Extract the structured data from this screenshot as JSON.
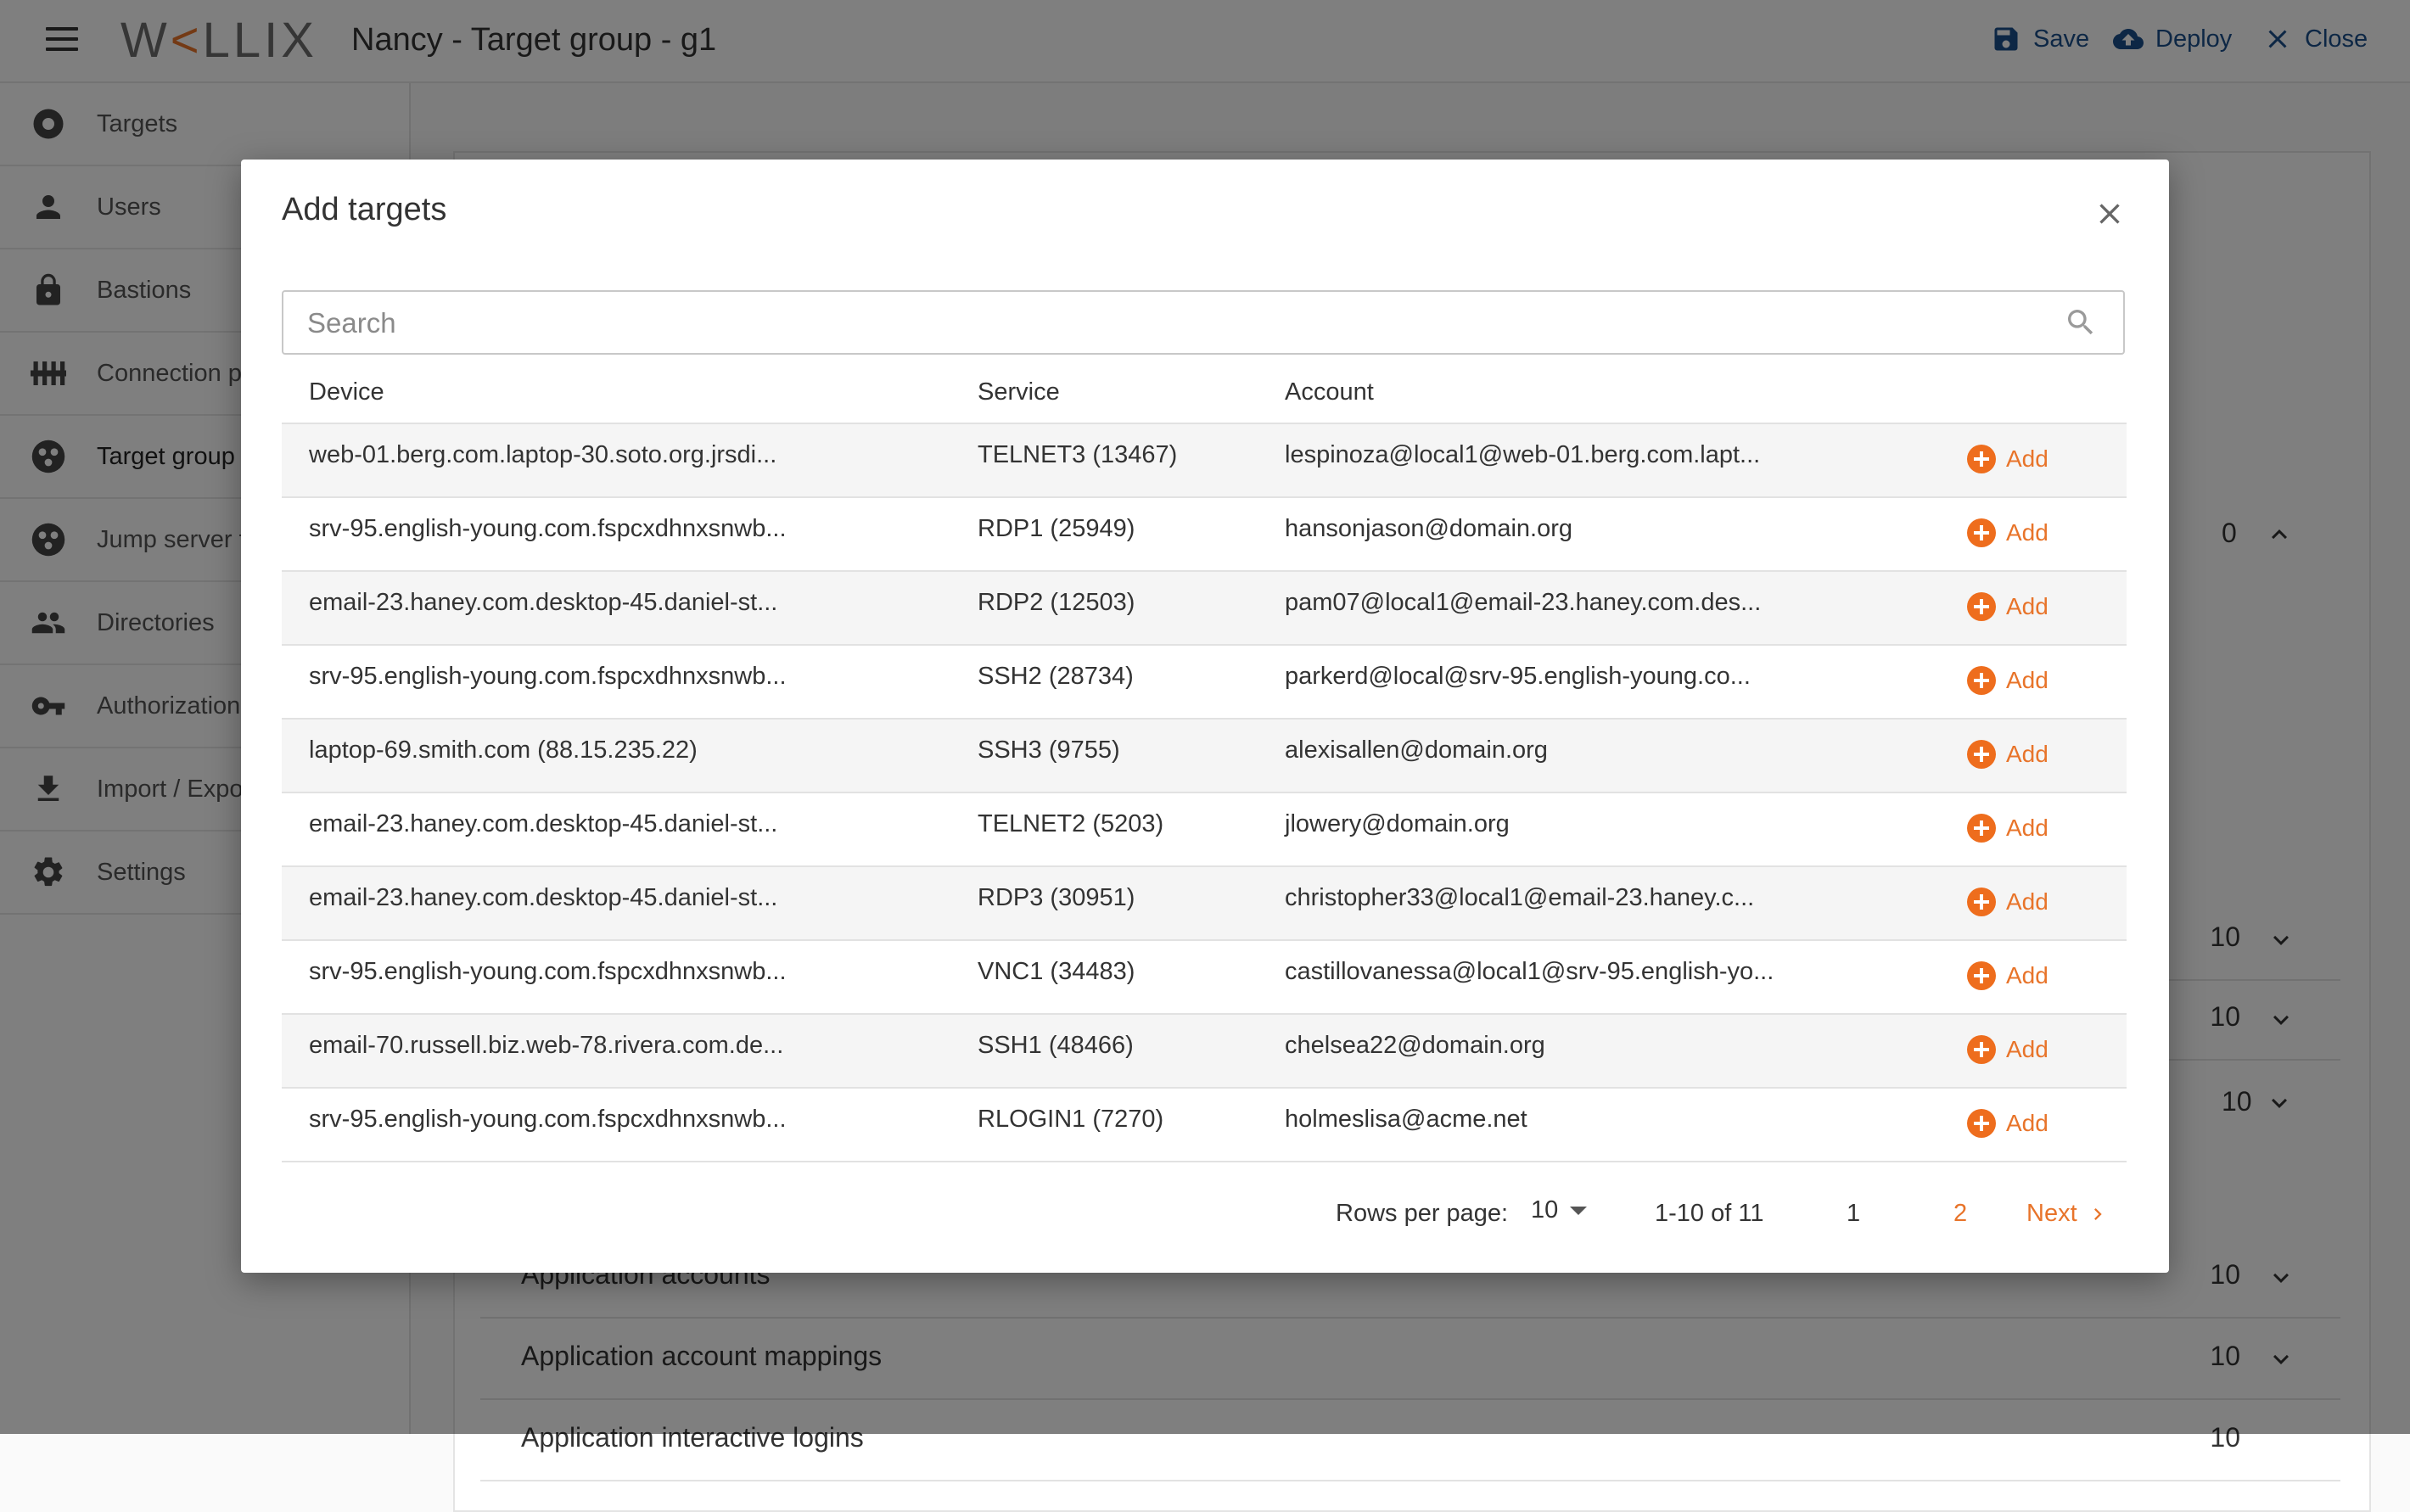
{
  "header": {
    "logo": "W<LLIX",
    "title": "Nancy -  Target group - g1",
    "actions": {
      "save": "Save",
      "deploy": "Deploy",
      "close": "Close"
    }
  },
  "sidebar": {
    "items": [
      {
        "label": "Targets",
        "icon": "target-icon"
      },
      {
        "label": "Users",
        "icon": "user-icon"
      },
      {
        "label": "Bastions",
        "icon": "lock-icon"
      },
      {
        "label": "Connection p",
        "icon": "sliders-icon"
      },
      {
        "label": "Target group",
        "icon": "group-icon",
        "active": true
      },
      {
        "label": "Jump server f",
        "icon": "group-icon"
      },
      {
        "label": "Directories",
        "icon": "people-icon"
      },
      {
        "label": "Authorization",
        "icon": "key-icon"
      },
      {
        "label": "Import / Expo",
        "icon": "download-icon"
      },
      {
        "label": "Settings",
        "icon": "gear-icon"
      }
    ]
  },
  "background": {
    "counts": [
      "0",
      "10",
      "10",
      "10"
    ],
    "rows": [
      {
        "label": "Application accounts",
        "count": "10"
      },
      {
        "label": "Application account mappings",
        "count": "10"
      },
      {
        "label": "Application interactive logins",
        "count": "10"
      }
    ]
  },
  "modal": {
    "title": "Add targets",
    "search_placeholder": "Search",
    "columns": {
      "device": "Device",
      "service": "Service",
      "account": "Account"
    },
    "add_label": "Add",
    "rows": [
      {
        "device": "web-01.berg.com.laptop-30.soto.org.jrsdi...",
        "service": "TELNET3 (13467)",
        "account": "lespinoza@local1@web-01.berg.com.lapt..."
      },
      {
        "device": "srv-95.english-young.com.fspcxdhnxsnwb...",
        "service": "RDP1 (25949)",
        "account": "hansonjason@domain.org"
      },
      {
        "device": "email-23.haney.com.desktop-45.daniel-st...",
        "service": "RDP2 (12503)",
        "account": "pam07@local1@email-23.haney.com.des..."
      },
      {
        "device": "srv-95.english-young.com.fspcxdhnxsnwb...",
        "service": "SSH2 (28734)",
        "account": "parkerd@local@srv-95.english-young.co..."
      },
      {
        "device": "laptop-69.smith.com (88.15.235.22)",
        "service": "SSH3 (9755)",
        "account": "alexisallen@domain.org"
      },
      {
        "device": "email-23.haney.com.desktop-45.daniel-st...",
        "service": "TELNET2 (5203)",
        "account": "jlowery@domain.org"
      },
      {
        "device": "email-23.haney.com.desktop-45.daniel-st...",
        "service": "RDP3 (30951)",
        "account": "christopher33@local1@email-23.haney.c..."
      },
      {
        "device": "srv-95.english-young.com.fspcxdhnxsnwb...",
        "service": "VNC1 (34483)",
        "account": "castillovanessa@local1@srv-95.english-yo..."
      },
      {
        "device": "email-70.russell.biz.web-78.rivera.com.de...",
        "service": "SSH1 (48466)",
        "account": "chelsea22@domain.org"
      },
      {
        "device": "srv-95.english-young.com.fspcxdhnxsnwb...",
        "service": "RLOGIN1 (7270)",
        "account": "holmeslisa@acme.net"
      }
    ],
    "pagination": {
      "rows_per_page_label": "Rows per page:",
      "rows_per_page": "10",
      "range": "1-10 of 11",
      "page1": "1",
      "page2": "2",
      "next": "Next"
    }
  },
  "colors": {
    "accent": "#e8742a",
    "primary": "#1b4f8a",
    "overlay": "rgba(0,0,0,0.5)"
  }
}
